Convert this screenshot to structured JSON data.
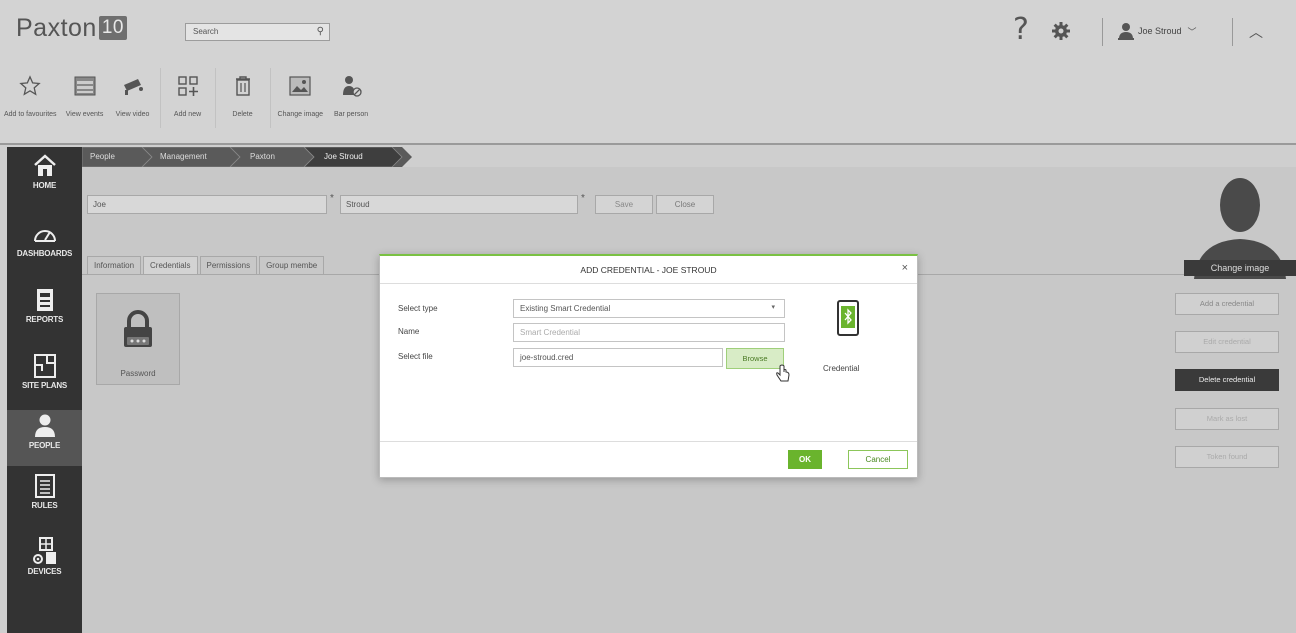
{
  "header": {
    "logo_text": "Paxton",
    "logo_badge": "10",
    "search_placeholder": "Search",
    "user_name": "Joe Stroud"
  },
  "toolbar": {
    "items": [
      {
        "label": "Add to favourites",
        "icon": "star-icon"
      },
      {
        "label": "View events",
        "icon": "events-icon"
      },
      {
        "label": "View video",
        "icon": "camera-icon"
      },
      {
        "label": "Add new",
        "icon": "add-new-icon"
      },
      {
        "label": "Delete",
        "icon": "trash-icon"
      },
      {
        "label": "Change image",
        "icon": "image-icon"
      },
      {
        "label": "Bar person",
        "icon": "bar-person-icon"
      }
    ]
  },
  "sidebar": {
    "items": [
      {
        "label": "HOME",
        "icon": "home-icon"
      },
      {
        "label": "DASHBOARDS",
        "icon": "gauge-icon"
      },
      {
        "label": "REPORTS",
        "icon": "reports-icon"
      },
      {
        "label": "SITE PLANS",
        "icon": "site-plans-icon"
      },
      {
        "label": "PEOPLE",
        "icon": "person-icon",
        "active": true
      },
      {
        "label": "RULES",
        "icon": "rules-icon"
      },
      {
        "label": "DEVICES",
        "icon": "devices-icon"
      }
    ]
  },
  "breadcrumb": [
    "People",
    "Management",
    "Paxton",
    "Joe Stroud"
  ],
  "person": {
    "first_name": "Joe",
    "last_name": "Stroud",
    "save_label": "Save",
    "close_label": "Close",
    "change_image_label": "Change image"
  },
  "tabs": [
    "Information",
    "Credentials",
    "Permissions",
    "Group membe"
  ],
  "credential_tile": {
    "label": "Password"
  },
  "side_buttons": [
    "Add a credential",
    "Edit credential",
    "Delete credential",
    "Mark as lost",
    "Token found"
  ],
  "modal": {
    "title": "ADD CREDENTIAL - JOE STROUD",
    "close": "×",
    "select_type_label": "Select type",
    "select_type_value": "Existing Smart Credential",
    "name_label": "Name",
    "name_placeholder": "Smart Credential",
    "file_label": "Select file",
    "file_value": "joe-stroud.cred",
    "browse_label": "Browse",
    "credential_caption": "Credential",
    "ok_label": "OK",
    "cancel_label": "Cancel"
  },
  "colors": {
    "accent_green": "#6ab42d",
    "sidebar_bg": "#333333",
    "breadcrumb_bg": "#4a4a4a"
  }
}
